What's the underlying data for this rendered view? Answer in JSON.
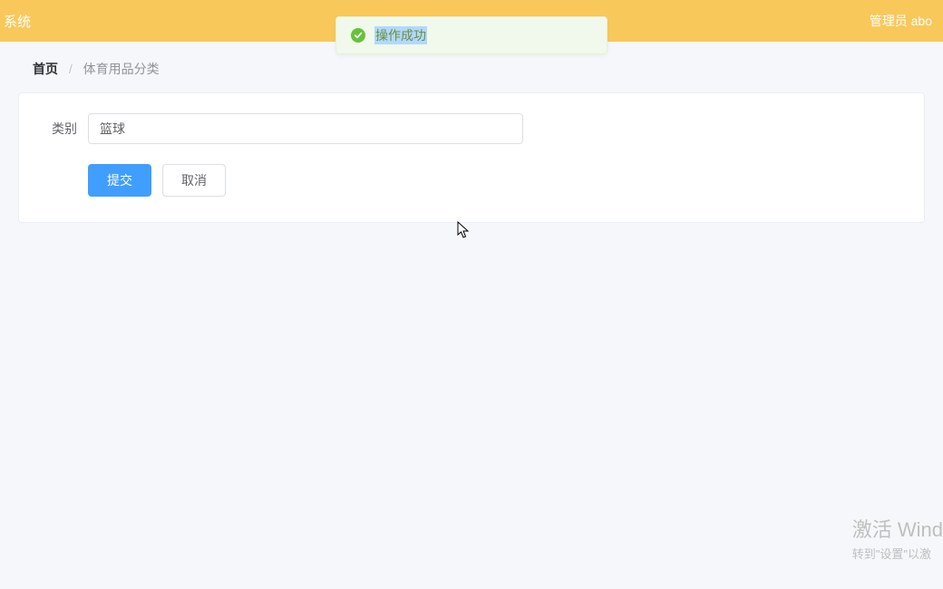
{
  "header": {
    "system_title": "系统",
    "user_label": "管理员 abo"
  },
  "toast": {
    "message": "操作成功"
  },
  "breadcrumb": {
    "home": "首页",
    "current": "体育用品分类"
  },
  "form": {
    "category_label": "类别",
    "category_value": "篮球",
    "submit_label": "提交",
    "cancel_label": "取消"
  },
  "watermark": {
    "title": "激活 Wind",
    "sub": "转到\"设置\"以激"
  }
}
